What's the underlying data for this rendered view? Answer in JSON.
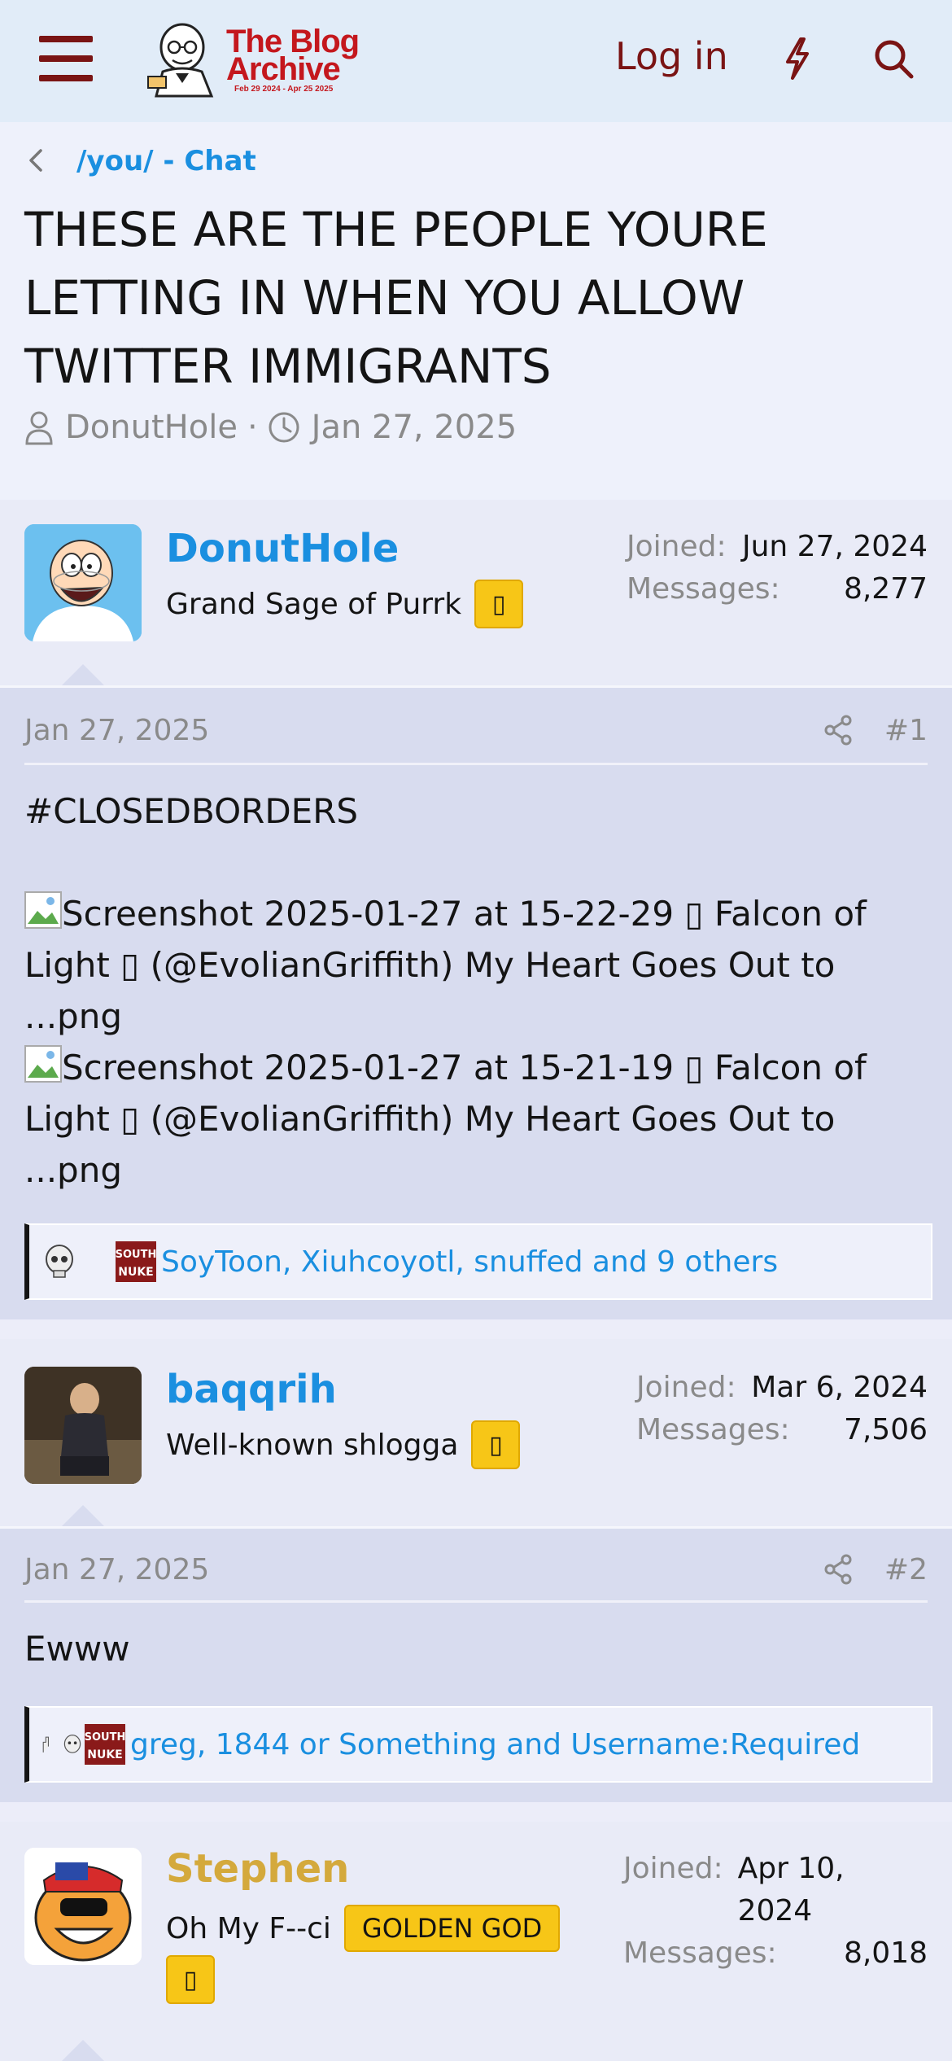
{
  "header": {
    "logo_title_line1": "The Blog",
    "logo_title_line2": "Archive",
    "logo_subtitle": "Feb 29 2024 - Apr 25 2025",
    "login_label": "Log in",
    "icons": [
      "menu-icon",
      "bolt-icon",
      "search-icon"
    ],
    "colors": {
      "bar_bg": "#e1ecf8",
      "accent": "#7a1414",
      "logo_red": "#c4171d"
    }
  },
  "breadcrumb": {
    "label": "/you/ - Chat"
  },
  "thread": {
    "title": "THESE ARE THE PEOPLE YOURE LETTING IN WHEN YOU ALLOW TWITTER IMMIGRANTS",
    "author": "DonutHole",
    "date": "Jan 27, 2025"
  },
  "posts": [
    {
      "username": "DonutHole",
      "user_title": "Grand Sage of Purrk",
      "badge": "▯",
      "joined_label": "Joined:",
      "joined": "Jun 27, 2024",
      "messages_label": "Messages:",
      "messages": "8,277",
      "date": "Jan 27, 2025",
      "number": "#1",
      "text_line1": "#CLOSEDBORDERS",
      "image1": "Screenshot 2025-01-27 at 15-22-29 ▯ Falcon of Light ▯ (@EvolianGriffith) My Heart Goes Out to ...png",
      "image2": "Screenshot 2025-01-27 at 15-21-19 ▯ Falcon of Light ▯ (@EvolianGriffith) My Heart Goes Out to ...png",
      "reactions": "SoyToon, Xiuhcoyotl, snuffed and 9 others"
    },
    {
      "username": "baqqrih",
      "user_title": "Well-known shlogga",
      "badge": "▯",
      "joined_label": "Joined:",
      "joined": "Mar 6, 2024",
      "messages_label": "Messages:",
      "messages": "7,506",
      "date": "Jan 27, 2025",
      "number": "#2",
      "text_line1": "Ewww",
      "reactions": "greg, 1844 or Something and Username:Required"
    },
    {
      "username": "Stephen",
      "user_title": "Oh My F--ci",
      "badge_text": "GOLDEN GOD",
      "badge": "▯",
      "joined_label": "Joined:",
      "joined": "Apr 10, 2024",
      "messages_label": "Messages:",
      "messages": "8,018",
      "username_color": "#d4a93c"
    }
  ]
}
